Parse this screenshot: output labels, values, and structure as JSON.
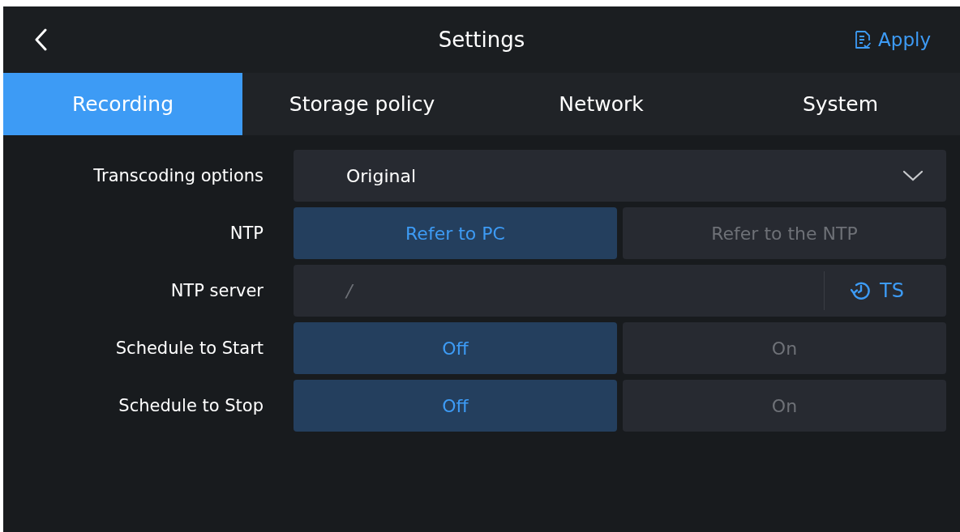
{
  "header": {
    "title": "Settings",
    "apply": "Apply"
  },
  "tabs": [
    {
      "label": "Recording",
      "selected": true
    },
    {
      "label": "Storage policy",
      "selected": false
    },
    {
      "label": "Network",
      "selected": false
    },
    {
      "label": "System",
      "selected": false
    }
  ],
  "rows": [
    {
      "kind": "dropdown",
      "label": "Transcoding options",
      "value": "Original"
    },
    {
      "kind": "segmented",
      "label": "NTP",
      "options": [
        {
          "label": "Refer to PC",
          "selected": true
        },
        {
          "label": "Refer to the NTP",
          "selected": false
        }
      ]
    },
    {
      "kind": "server",
      "label": "NTP server",
      "value": "/",
      "button": "TS"
    },
    {
      "kind": "segmented",
      "label": "Schedule to Start",
      "options": [
        {
          "label": "Off",
          "selected": true
        },
        {
          "label": "On",
          "selected": false
        }
      ]
    },
    {
      "kind": "segmented",
      "label": "Schedule to Stop",
      "options": [
        {
          "label": "Off",
          "selected": true
        },
        {
          "label": "On",
          "selected": false
        }
      ]
    }
  ]
}
